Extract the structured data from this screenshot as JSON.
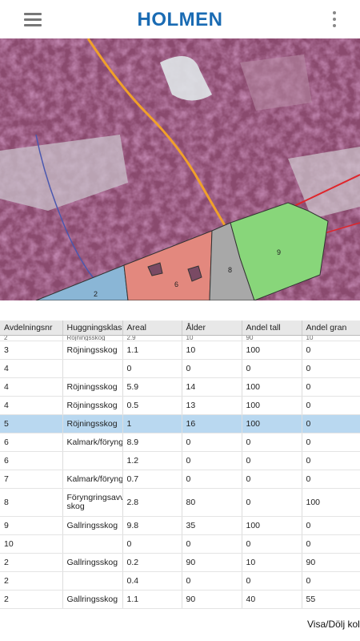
{
  "header": {
    "logo_text": "HOLMEN"
  },
  "map": {
    "parcels": [
      {
        "id": "2",
        "color": "#8ab6d6"
      },
      {
        "id": "6",
        "color": "#e3887e"
      },
      {
        "id": "8",
        "color": "#a8a8a8"
      },
      {
        "id": "9",
        "color": "#88d67a"
      }
    ],
    "labels": [
      "9",
      "8",
      "6",
      "2"
    ]
  },
  "table": {
    "columns": [
      "Avdelningsnr",
      "Huggningsklass",
      "Areal",
      "Ålder",
      "Andel tall",
      "Andel gran"
    ],
    "partial_row": [
      "2",
      "Röjningsskog",
      "2.9",
      "10",
      "90",
      "10"
    ],
    "rows": [
      [
        "3",
        "Röjningsskog",
        "1.1",
        "10",
        "100",
        "0"
      ],
      [
        "4",
        "",
        "0",
        "0",
        "0",
        "0"
      ],
      [
        "4",
        "Röjningsskog",
        "5.9",
        "14",
        "100",
        "0"
      ],
      [
        "4",
        "Röjningsskog",
        "0.5",
        "13",
        "100",
        "0"
      ],
      [
        "5",
        "Röjningsskog",
        "1",
        "16",
        "100",
        "0"
      ],
      [
        "6",
        "Kalmark/föryngringsyta",
        "8.9",
        "0",
        "0",
        "0"
      ],
      [
        "6",
        "",
        "1.2",
        "0",
        "0",
        "0"
      ],
      [
        "7",
        "Kalmark/föryngringsyta",
        "0.7",
        "0",
        "0",
        "0"
      ],
      [
        "8",
        "Föryngringsavv-skog",
        "2.8",
        "80",
        "0",
        "100"
      ],
      [
        "9",
        "Gallringsskog",
        "9.8",
        "35",
        "100",
        "0"
      ],
      [
        "10",
        "",
        "0",
        "0",
        "0",
        "0"
      ],
      [
        "2",
        "Gallringsskog",
        "0.2",
        "90",
        "10",
        "90"
      ],
      [
        "2",
        "",
        "0.4",
        "0",
        "0",
        "0"
      ],
      [
        "2",
        "Gallringsskog",
        "1.1",
        "90",
        "40",
        "55"
      ]
    ],
    "selected_row_index": 4
  },
  "footer": {
    "toggle_text": "Visa/Dölj kolumner"
  }
}
